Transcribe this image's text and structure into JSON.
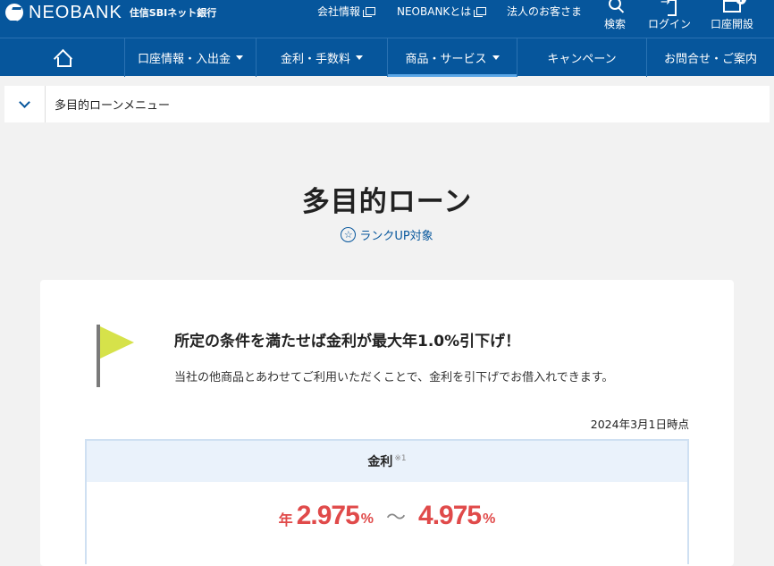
{
  "header": {
    "logo_text": "NEOBANK",
    "logo_sub": "住信SBIネット銀行",
    "links": [
      "会社情報",
      "NEOBANKとは",
      "法人のお客さま"
    ],
    "buttons": {
      "search": "検索",
      "login": "ログイン",
      "open_account": "口座開設"
    }
  },
  "nav": {
    "items": [
      "口座情報・入出金",
      "金利・手数料",
      "商品・サービス",
      "キャンペーン",
      "お問合せ・ご案内"
    ],
    "active_index": 2
  },
  "sub_menu": {
    "label": "多目的ローンメニュー"
  },
  "page": {
    "title": "多目的ローン",
    "rank_label": "ランクUP対象"
  },
  "promo": {
    "title": "所定の条件を満たせば金利が最大年1.0%引下げ！",
    "subtitle": "当社の他商品とあわせてご利用いただくことで、金利を引下げでお借入れできます。",
    "as_of": "2024年3月1日時点"
  },
  "rate": {
    "header": "金利",
    "note": "※1",
    "prefix": "年",
    "min": "2.975",
    "max": "4.975",
    "unit": "%",
    "separator": "〜"
  },
  "colors": {
    "brand": "#06569c",
    "rate_red": "#e04a4a",
    "flag": "#d6e24a"
  }
}
